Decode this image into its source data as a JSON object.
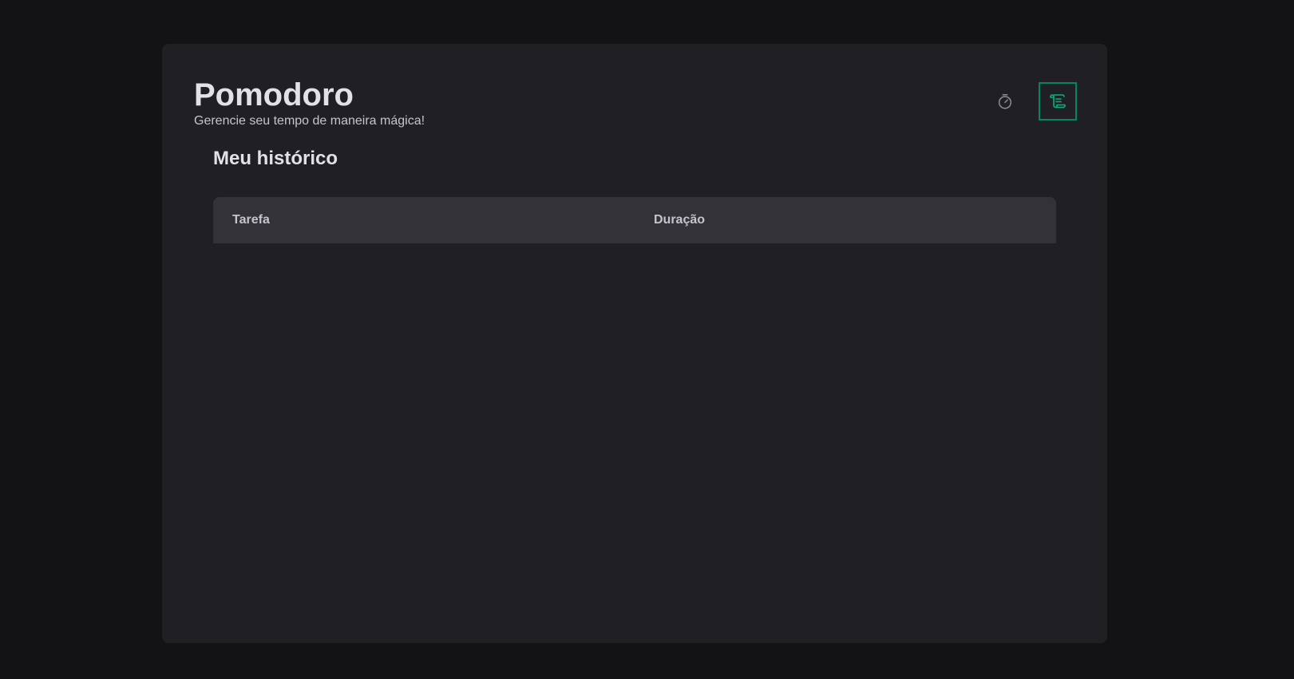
{
  "header": {
    "title": "Pomodoro",
    "subtitle": "Gerencie seu tempo de maneira mágica!"
  },
  "nav": {
    "items": [
      {
        "icon": "timer-icon",
        "active": false
      },
      {
        "icon": "scroll-icon",
        "active": true
      }
    ]
  },
  "history": {
    "title": "Meu histórico",
    "columns": [
      "Tarefa",
      "Duração"
    ],
    "rows": []
  },
  "colors": {
    "background": "#131316",
    "card": "#202024",
    "table_header": "#323238",
    "accent": "#00875f",
    "text": "#e1e1e6",
    "text_muted": "#c4c4cc",
    "icon_inactive": "#8d8d99"
  }
}
